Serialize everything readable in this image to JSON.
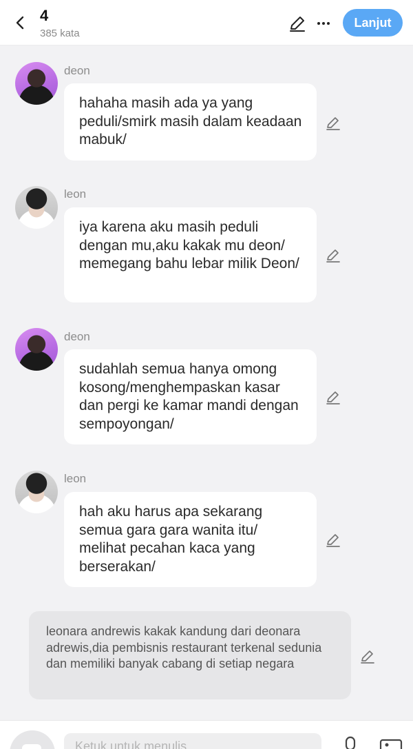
{
  "header": {
    "chapter_title": "4",
    "word_count": "385 kata",
    "next_label": "Lanjut"
  },
  "messages": [
    {
      "speaker": "deon",
      "text": "hahaha masih ada ya yang peduli/smirk masih dalam keadaan mabuk/"
    },
    {
      "speaker": "leon",
      "text": "iya karena aku masih peduli dengan mu,aku kakak mu deon/ memegang bahu lebar milik Deon/"
    },
    {
      "speaker": "deon",
      "text": "sudahlah semua hanya omong kosong/menghempaskan kasar dan pergi ke kamar mandi dengan sempoyongan/"
    },
    {
      "speaker": "leon",
      "text": "hah aku harus apa sekarang semua gara gara wanita itu/ melihat pecahan kaca yang berserakan/"
    }
  ],
  "narration": {
    "text": "leonara andrewis kakak kandung dari deonara adrewis,dia pembisnis restaurant terkenal sedunia dan memiliki banyak cabang di setiap negara"
  },
  "input": {
    "placeholder": "Ketuk untuk menulis"
  },
  "icons": {
    "back": "chevron-left-icon",
    "edit": "pencil-icon",
    "more": "more-horizontal-icon",
    "mic": "microphone-icon",
    "image": "image-icon"
  },
  "colors": {
    "accent": "#5aa8f5",
    "background": "#f2f2f4",
    "bubble": "#ffffff",
    "narration": "#e6e6e8"
  }
}
